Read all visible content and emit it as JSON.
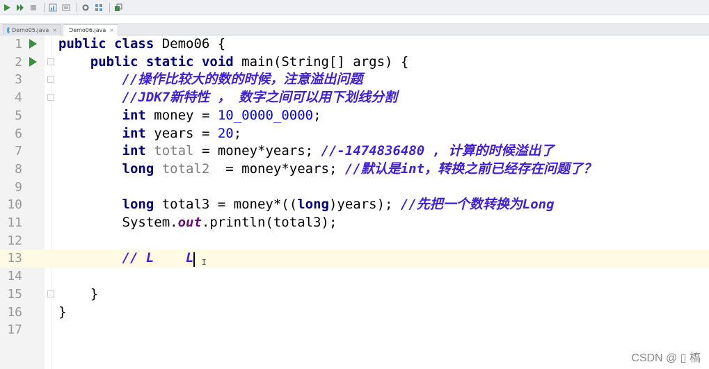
{
  "toolbar": {
    "icons": [
      "run-icon",
      "debug-icon",
      "stop-icon",
      "coverage-icon",
      "build-icon",
      "settings-icon",
      "structure-icon",
      "deploy-icon"
    ]
  },
  "tabs": [
    {
      "label": "Demo05.java",
      "active": false
    },
    {
      "label": "Demo06.java",
      "active": true
    }
  ],
  "editor": {
    "current_line": 13,
    "lines": [
      {
        "n": "1",
        "run": true,
        "fold": false
      },
      {
        "n": "2",
        "run": true,
        "fold": true
      },
      {
        "n": "3",
        "run": false,
        "fold": true
      },
      {
        "n": "4",
        "run": false,
        "fold": true
      },
      {
        "n": "5"
      },
      {
        "n": "6"
      },
      {
        "n": "7"
      },
      {
        "n": "8"
      },
      {
        "n": "9"
      },
      {
        "n": "10"
      },
      {
        "n": "11"
      },
      {
        "n": "12"
      },
      {
        "n": "13"
      },
      {
        "n": "14"
      },
      {
        "n": "15",
        "fold": true
      },
      {
        "n": "16"
      },
      {
        "n": "17"
      }
    ],
    "code": {
      "l1": {
        "kw1": "public",
        "kw2": "class",
        "rest": " Demo06 {"
      },
      "l2": {
        "kw1": "public",
        "kw2": "static",
        "kw3": "void",
        "rest": " main(String[] args) {"
      },
      "l3": {
        "comment": "//操作比较大的数的时候，注意溢出问题"
      },
      "l4": {
        "comment": "//JDK7新特性 ， 数字之间可以用下划线分割"
      },
      "l5": {
        "kw": "int",
        "name": "money",
        "op": " = ",
        "num": "10_0000_0000",
        "end": ";"
      },
      "l6": {
        "kw": "int",
        "name": "years",
        "op": " = ",
        "num": "20",
        "end": ";"
      },
      "l7": {
        "kw": "int",
        "name": "total",
        "rest": " = money*years; ",
        "comment": "//-1474836480 , 计算的时候溢出了"
      },
      "l8": {
        "kw": "long",
        "name": "total2",
        "rest": "  = money*years; ",
        "comment": "//默认是int，转换之前已经存在问题了？"
      },
      "l10": {
        "kw": "long",
        "pre": " total3 = money*((",
        "kw2": "long",
        "rest": ")years); ",
        "comment": "//先把一个数转换为Long"
      },
      "l11": {
        "a": "System.",
        "out": "out",
        "b": ".println(total3);"
      },
      "l13": {
        "comment": "// L    L"
      },
      "l15": {
        "text": "}"
      },
      "l16": {
        "text": "}"
      }
    }
  },
  "cursor_glyph": "I",
  "watermark": "CSDN @ ▯ 槗"
}
